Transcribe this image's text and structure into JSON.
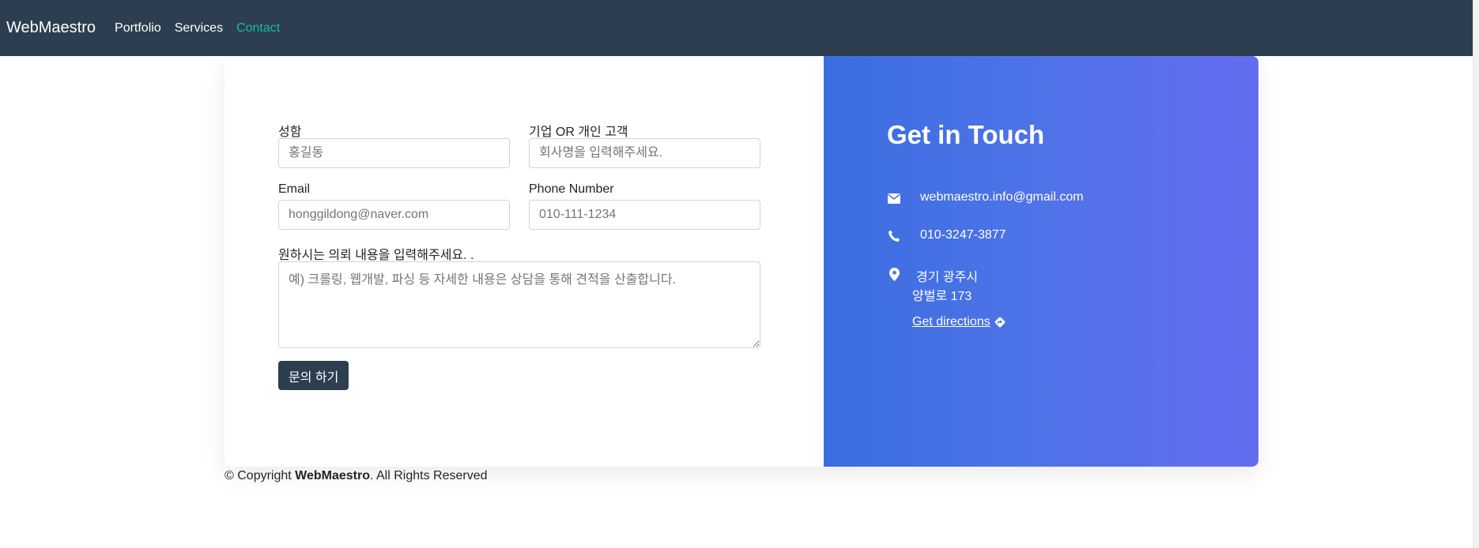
{
  "navbar": {
    "brand": "WebMaestro",
    "links": [
      {
        "label": "Portfolio"
      },
      {
        "label": "Services"
      },
      {
        "label": "Contact"
      }
    ]
  },
  "form": {
    "name_label": "성함",
    "name_placeholder": "홍길동",
    "company_label": "기업 OR 개인 고객",
    "company_placeholder": "회사명을 입력해주세요.",
    "email_label": "Email",
    "email_placeholder": "honggildong@naver.com",
    "phone_label": "Phone Number",
    "phone_placeholder": "010-111-1234",
    "message_label": "원하시는 의뢰 내용을 입력해주세요. .",
    "message_placeholder": "예) 크롤링, 웹개발, 파싱 등 자세한 내용은 상담을 통해 견적을 산출합니다.",
    "submit_label": "문의 하기"
  },
  "info": {
    "title": "Get in Touch",
    "email": "webmaestro.info@gmail.com",
    "phone": "010-3247-3877",
    "address_line1": "경기 광주시",
    "address_line2": "양벌로 173",
    "directions_label": "Get directions"
  },
  "footer": {
    "prefix": "© Copyright ",
    "brand": "WebMaestro",
    "suffix": ". All Rights Reserved"
  },
  "colors": {
    "navbar_bg": "#2c3e50",
    "nav_active": "#18bc9c",
    "panel_gradient_start": "#3a6ee0",
    "panel_gradient_end": "#636def"
  }
}
